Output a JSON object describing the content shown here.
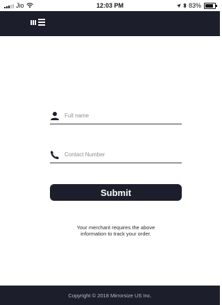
{
  "status_bar": {
    "carrier": "Jio",
    "time": "12:03 PM",
    "battery": "83%"
  },
  "header": {
    "logo_icon": "mirrorsize-logo-icon"
  },
  "form": {
    "full_name": {
      "placeholder": "Full name",
      "value": "",
      "icon": "person-icon"
    },
    "contact_number": {
      "placeholder": "Contact Number",
      "value": "",
      "icon": "phone-icon"
    },
    "submit_label": "Submit",
    "info_line1": "Your merchant requires the above",
    "info_line2": "information to track your order."
  },
  "footer": {
    "copyright": "Copyright © 2018 Mirrorsize US Inc."
  },
  "colors": {
    "brand_dark": "#1c1e2b",
    "background": "#ffffff"
  }
}
